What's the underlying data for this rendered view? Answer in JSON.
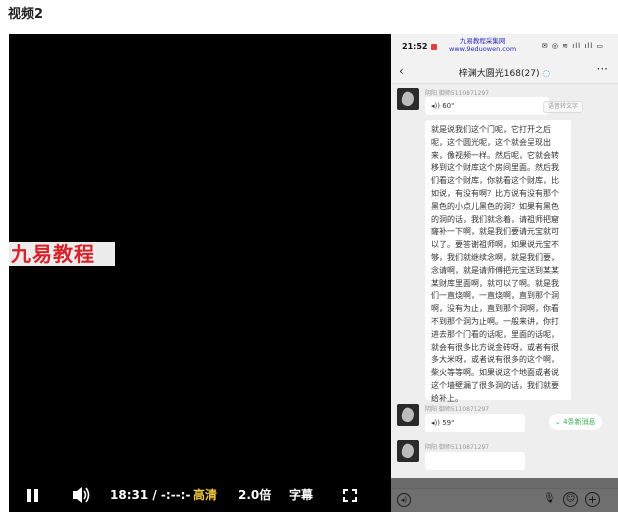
{
  "page": {
    "title": "视频2"
  },
  "watermark": {
    "banner_text": "九易教程"
  },
  "phone": {
    "status": {
      "time": "21:52",
      "icons": "✉ ◎ ≋ ıll ıll ▭"
    },
    "overlay": {
      "line1": "九易教程采集网",
      "line2": "www.9eduowen.com"
    },
    "header": {
      "title": "梓渊大圆光168(27)",
      "back": "‹",
      "more": "···",
      "title_icon": "chat-bubble-icon"
    },
    "messages": [
      {
        "sender": "阴阳 御师5110871297",
        "type": "voice",
        "duration": "60\"",
        "chip": "语音转文字"
      },
      {
        "type": "text",
        "text": "就是说我们这个门呢，它打开之后呢，这个圆光呢，这个就会呈现出来，像视频一样。然后呢，它就会转移到这个财库这个房间里面。然后我们看这个财库，你就看这个财库，比如说，有没有啊？比方说有没有那个黑色的小点儿黑色的洞？如果有黑色的洞的话，我们就念着，请祖师把窟窿补一下啊，就是我们要请元宝就可以了。要答谢祖师啊，如果说元宝不够，我们就继续念啊，就是我们要，念请啊，就是请师傅把元宝送到某某某财库里面啊，就可以了啊。就是我们一直烧啊，一直烧啊，直到那个洞啊，没有为止，直到那个洞啊，你看不到那个洞为止啊。一般来讲，你打进去那个门看的话呢，里面的话呢，就会有很多比方说金砖呀，或者有很多大米呀，或者说有很多的这个啊，柴火等等啊。如果说这个地面或者说这个墙壁漏了很多洞的话，我们就要给补上。"
      },
      {
        "sender": "阴阳 御师5110871297",
        "type": "voice",
        "duration": "59\"",
        "chip": "4条新消息"
      },
      {
        "sender": "阴阳 御师5110871297",
        "type": "voice",
        "duration": ""
      }
    ]
  },
  "controls": {
    "time": "18:31 / -:--:-",
    "quality": "高清",
    "speed": "2.0倍",
    "subtitle": "字幕"
  }
}
